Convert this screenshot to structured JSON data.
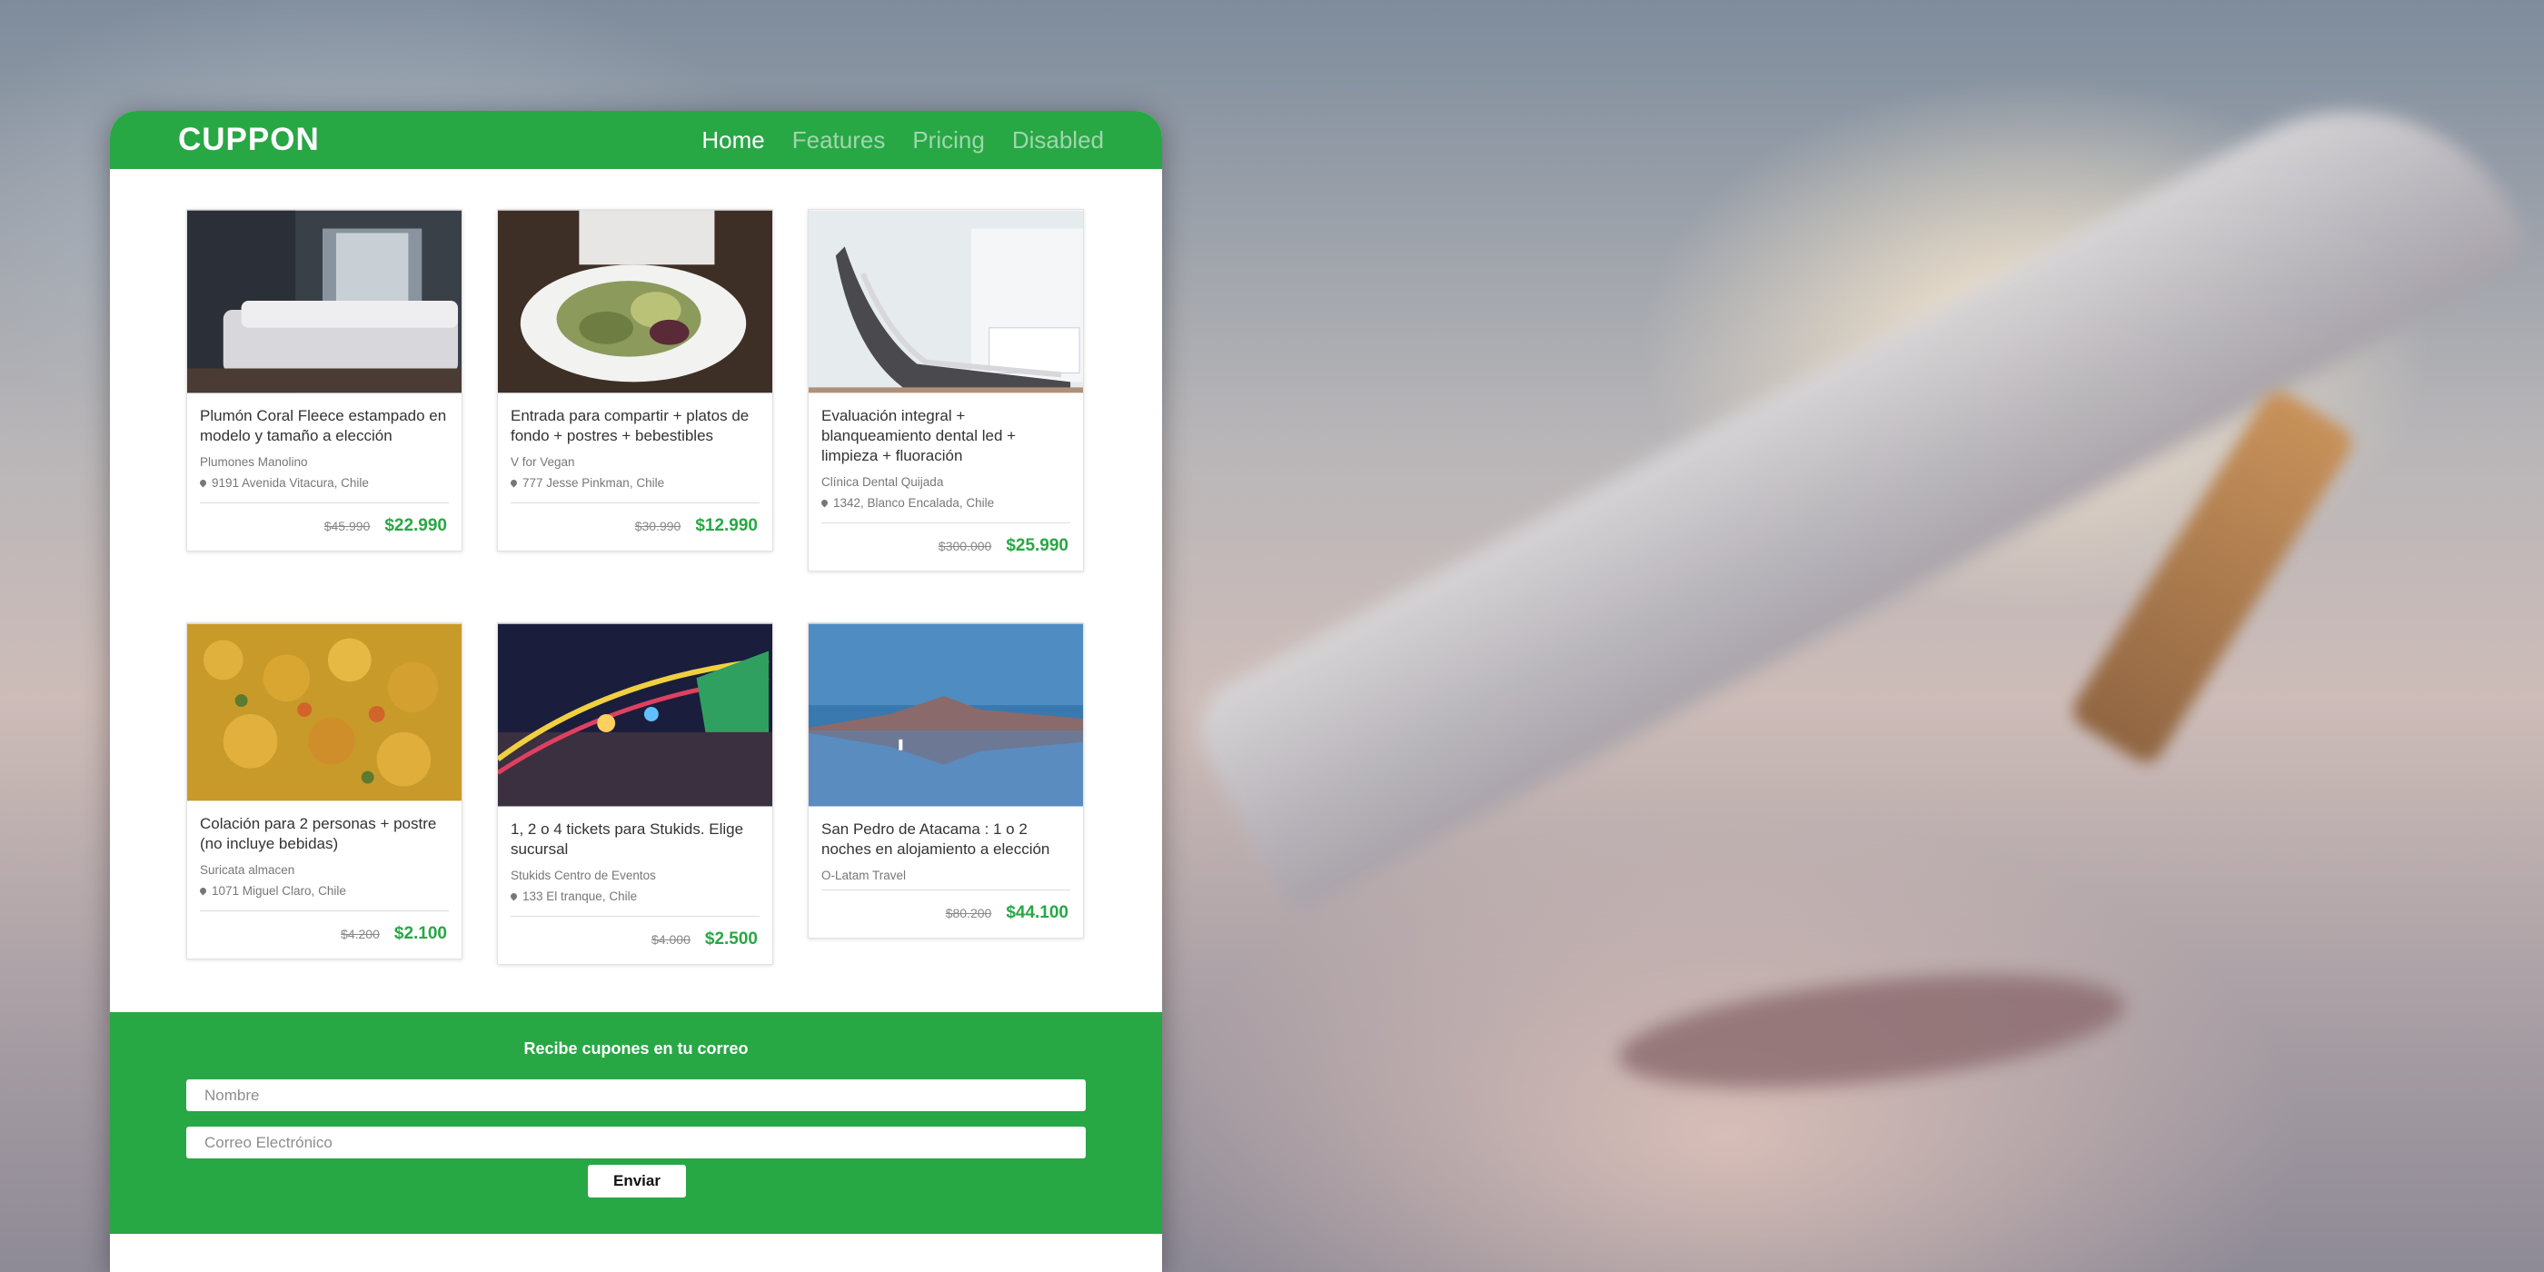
{
  "brand": "CUPPON",
  "nav": {
    "home": "Home",
    "features": "Features",
    "pricing": "Pricing",
    "disabled": "Disabled"
  },
  "cards": [
    {
      "image": "bedroom-photo",
      "title": "Plumón Coral Fleece estampado en modelo y tamaño a elección",
      "vendor": "Plumones Manolino",
      "location": "9191 Avenida Vitacura, Chile",
      "old_price": "$45.990",
      "new_price": "$22.990"
    },
    {
      "image": "salad-plate-photo",
      "title": "Entrada para compartir + platos de fondo + postres + bebestibles",
      "vendor": "V for Vegan",
      "location": "777 Jesse Pinkman, Chile",
      "old_price": "$30.990",
      "new_price": "$12.990"
    },
    {
      "image": "dental-chair-photo",
      "title": "Evaluación integral + blanqueamiento dental led + limpieza + fluoración",
      "vendor": "Clínica Dental Quijada",
      "location": "1342, Blanco Encalada, Chile",
      "old_price": "$300.000",
      "new_price": "$25.990"
    },
    {
      "image": "food-dish-photo",
      "title": "Colación para 2 personas + postre (no incluye bebidas)",
      "vendor": "Suricata almacen",
      "location": "1071 Miguel Claro, Chile",
      "old_price": "$4.200",
      "new_price": "$2.100"
    },
    {
      "image": "fair-night-photo",
      "title": "1, 2 o 4 tickets para Stukids. Elige sucursal",
      "vendor": "Stukids Centro de Eventos",
      "location": "133 El tranque, Chile",
      "old_price": "$4.000",
      "new_price": "$2.500"
    },
    {
      "image": "atacama-lagoon-photo",
      "title": "San Pedro de Atacama : 1 o 2 noches en alojamiento a elección",
      "vendor": "O-Latam Travel",
      "location": "",
      "old_price": "$80.200",
      "new_price": "$44.100"
    }
  ],
  "newsletter": {
    "title": "Recibe cupones en tu correo",
    "name_placeholder": "Nombre",
    "email_placeholder": "Correo Electrónico",
    "submit_label": "Enviar"
  },
  "colors": {
    "brand_green": "#28a745",
    "price_green": "#28a745"
  }
}
